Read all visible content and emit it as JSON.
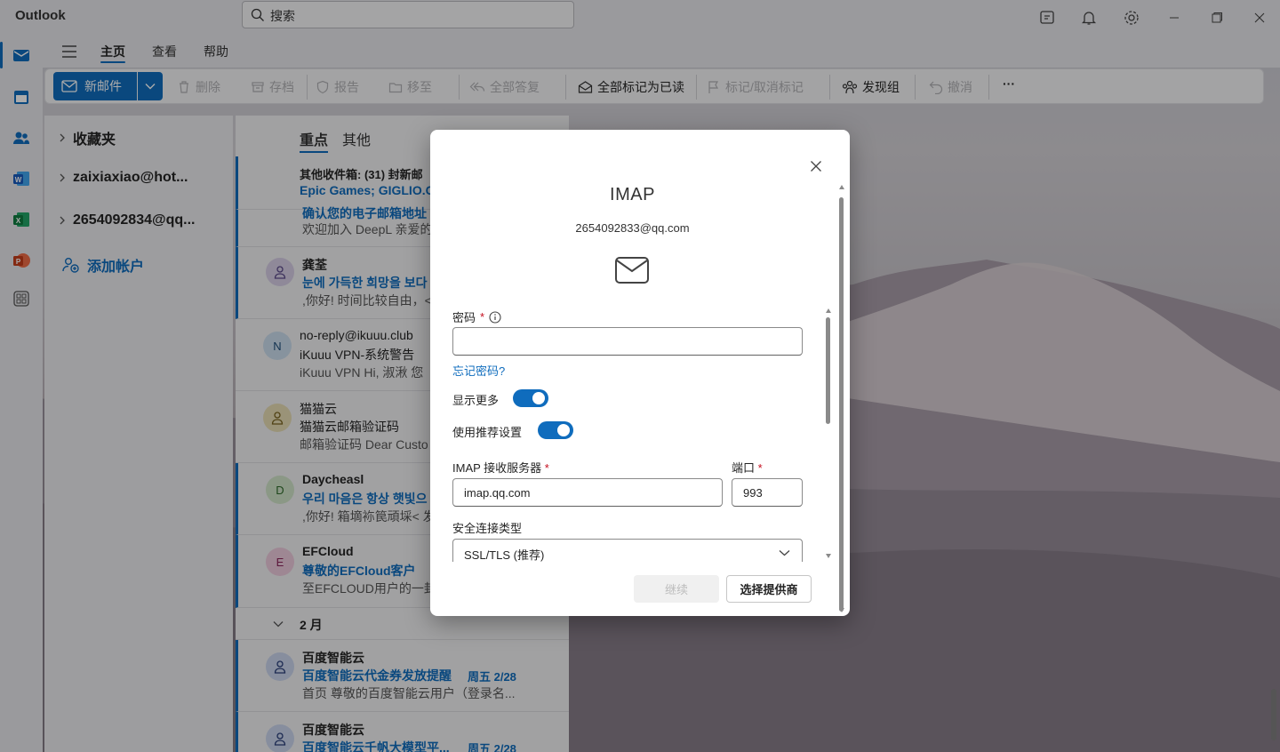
{
  "app": {
    "title": "Outlook"
  },
  "search": {
    "placeholder": "搜索"
  },
  "titlebar_icons": [
    "notes-icon",
    "bell-icon",
    "gear-icon",
    "minimize-icon",
    "restore-icon",
    "close-icon"
  ],
  "menu": {
    "tabs": [
      "主页",
      "查看",
      "帮助"
    ],
    "active": "主页"
  },
  "ribbon": {
    "new_mail": "新邮件",
    "delete": "删除",
    "archive": "存档",
    "report": "报告",
    "move": "移至",
    "reply_all": "全部答复",
    "mark_all_read": "全部标记为已读",
    "flag": "标记/取消标记",
    "discover_groups": "发现组",
    "undo": "撤消",
    "more": "···"
  },
  "folders": {
    "favorites": "收藏夹",
    "account1": "zaixiaxiao@hot...",
    "account2": "2654092834@qq...",
    "add_account": "添加帐户"
  },
  "inbox_tabs": {
    "focused": "重点",
    "other": "其他"
  },
  "messages": {
    "other_banner": {
      "line1": "其他收件箱: (31) 封新邮",
      "line2": "Epic Games; GIGLIO.C"
    },
    "partial": {
      "line2": "确认您的电子邮箱地址",
      "line3": "欢迎加入 DeepL 亲爱的"
    },
    "m1": {
      "sender": "龚荃",
      "subject": "눈에 가득한 희망을 보다",
      "preview": ",你好! 时间比较自由，<"
    },
    "m2": {
      "avatar": "N",
      "sender": "no-reply@ikuuu.club",
      "subject": "iKuuu VPN-系统警告",
      "preview": "iKuuu VPN Hi, 淑湫 您"
    },
    "m3": {
      "sender": "猫猫云",
      "subject": "猫猫云邮箱验证码",
      "preview": "邮箱验证码 Dear Custo"
    },
    "m4": {
      "avatar": "D",
      "sender": "Daycheasl",
      "subject": "우리 마음은 항상 햇빛으",
      "preview": ",你好! 箱墑袮笢頑埰< 发"
    },
    "m5": {
      "avatar": "E",
      "sender": "EFCloud",
      "subject": "尊敬的EFCloud客户",
      "preview": "至EFCLOUD用户的一封"
    },
    "group_header": "2 月",
    "m6": {
      "sender": "百度智能云",
      "subject": "百度智能云代金券发放提醒",
      "date": "周五 2/28",
      "preview": "首页 尊敬的百度智能云用户（登录名..."
    },
    "m7": {
      "sender": "百度智能云",
      "subject": "百度智能云千帆大模型平...",
      "date": "周五 2/28"
    }
  },
  "dialog": {
    "title": "IMAP",
    "email": "2654092833@qq.com",
    "password_label": "密码",
    "password_value": "",
    "forgot_password": "忘记密码?",
    "show_more": "显示更多",
    "use_recommended": "使用推荐设置",
    "show_more_on": true,
    "use_recommended_on": true,
    "imap_server_label": "IMAP 接收服务器",
    "imap_server_value": "imap.qq.com",
    "port_label": "端口",
    "port_value": "993",
    "security_label": "安全连接类型",
    "security_value": "SSL/TLS (推荐)",
    "required_mark": "*",
    "continue": "继续",
    "choose_provider": "选择提供商"
  },
  "colors": {
    "accent": "#0f6cbd",
    "required": "#c50f1f"
  }
}
